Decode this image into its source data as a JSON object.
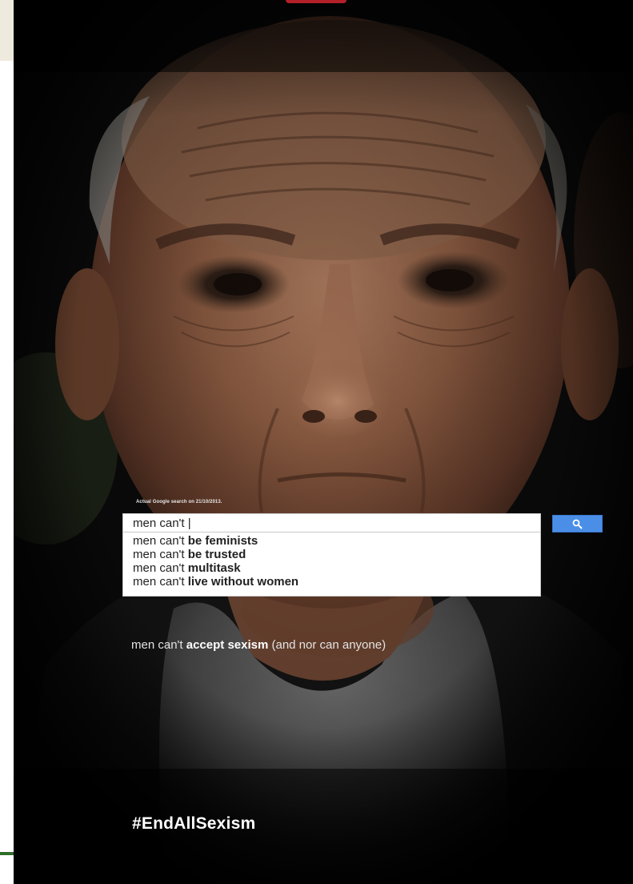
{
  "poster": {
    "caption": "Actual Google search on 21/10/2013.",
    "search": {
      "query": "men can't |",
      "button_icon": "search-icon"
    },
    "suggestions": [
      {
        "prefix": "men can't ",
        "completion": "be feminists"
      },
      {
        "prefix": "men can't ",
        "completion": "be trusted"
      },
      {
        "prefix": "men can't ",
        "completion": "multitask"
      },
      {
        "prefix": "men can't ",
        "completion": "live without women"
      }
    ],
    "tagline": {
      "part1": "men can't ",
      "bold1": "accept",
      "part2": " ",
      "bold2": "sexism",
      "part3": " (and nor can anyone)"
    },
    "hashtag": "#EndAllSexism"
  },
  "colors": {
    "button_blue": "#4a8ee8",
    "background_dark": "#050505"
  }
}
